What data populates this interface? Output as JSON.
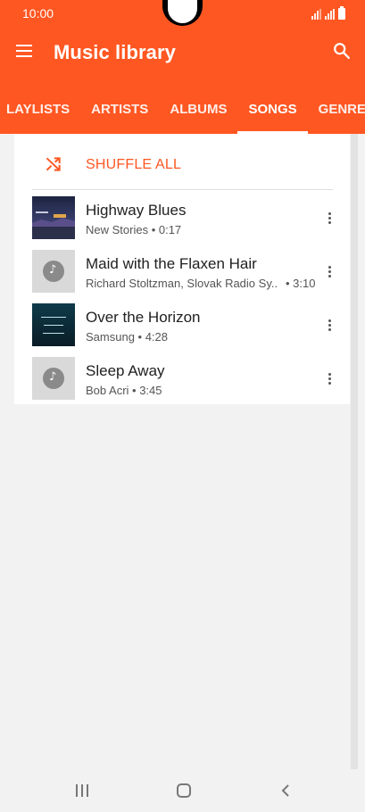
{
  "status_bar": {
    "time": "10:00"
  },
  "app_bar": {
    "title": "Music library",
    "tabs": [
      {
        "label": "LAYLISTS"
      },
      {
        "label": "ARTISTS"
      },
      {
        "label": "ALBUMS"
      },
      {
        "label": "SONGS",
        "active": true
      },
      {
        "label": "GENRES"
      }
    ]
  },
  "shuffle": {
    "label": "SHUFFLE ALL"
  },
  "songs": [
    {
      "title": "Highway Blues",
      "subtitle": "New Stories • 0:17",
      "art": "album-art"
    },
    {
      "title": "Maid with the Flaxen Hair",
      "subtitle": "Richard Stoltzman, Slovak Radio Sy..",
      "duration": "• 3:10",
      "art": "music-note-placeholder"
    },
    {
      "title": "Over the Horizon",
      "subtitle": "Samsung • 4:28",
      "art": "album-art"
    },
    {
      "title": "Sleep Away",
      "subtitle": "Bob Acri • 3:45",
      "art": "music-note-placeholder"
    }
  ],
  "colors": {
    "accent": "#ff5722",
    "background": "#f2f2f2",
    "card": "#ffffff"
  },
  "icons": [
    "menu-icon",
    "search-icon",
    "shuffle-icon",
    "more-vert-icon",
    "music-note-icon",
    "nav-recent-icon",
    "nav-home-icon",
    "nav-back-icon"
  ]
}
